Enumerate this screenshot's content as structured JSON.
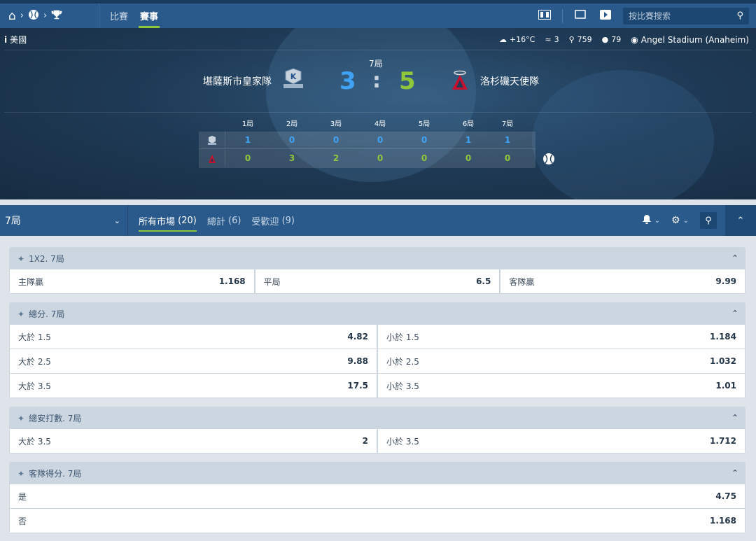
{
  "nav": {
    "tabs": [
      "比賽",
      "賽事"
    ],
    "active_tab": "賽事",
    "search_placeholder": "按比賽搜索"
  },
  "match": {
    "country": "美國",
    "weather": {
      "temp": "+16°C",
      "wind": "3",
      "pressure": "759",
      "humidity": "79"
    },
    "venue": "Angel Stadium (Anaheim)",
    "inning": "7局",
    "home_team": "堪薩斯市皇家隊",
    "away_team": "洛杉磯天使隊",
    "home_score": "3",
    "away_score": "5",
    "separator": ":",
    "innings": [
      "1局",
      "2局",
      "3局",
      "4局",
      "5局",
      "6局",
      "7局"
    ],
    "home_line": [
      "1",
      "0",
      "0",
      "0",
      "0",
      "1",
      "1"
    ],
    "away_line": [
      "0",
      "3",
      "2",
      "0",
      "0",
      "0",
      "0"
    ],
    "colors": {
      "home": "#3fa3f5",
      "away": "#8fc63c"
    }
  },
  "marketbar": {
    "period": "7局",
    "tabs": [
      {
        "label": "所有市場",
        "count": "(20)"
      },
      {
        "label": "總計",
        "count": "(6)"
      },
      {
        "label": "受歡迎",
        "count": "(9)"
      }
    ]
  },
  "markets": [
    {
      "title": "1X2. 7局",
      "rows": [
        [
          {
            "label": "主隊贏",
            "odd": "1.168"
          },
          {
            "label": "平局",
            "odd": "6.5"
          },
          {
            "label": "客隊贏",
            "odd": "9.99"
          }
        ]
      ]
    },
    {
      "title": "總分. 7局",
      "rows": [
        [
          {
            "label": "大於 1.5",
            "odd": "4.82"
          },
          {
            "label": "小於 1.5",
            "odd": "1.184"
          }
        ],
        [
          {
            "label": "大於 2.5",
            "odd": "9.88"
          },
          {
            "label": "小於 2.5",
            "odd": "1.032"
          }
        ],
        [
          {
            "label": "大於 3.5",
            "odd": "17.5"
          },
          {
            "label": "小於 3.5",
            "odd": "1.01"
          }
        ]
      ]
    },
    {
      "title": "總安打數. 7局",
      "rows": [
        [
          {
            "label": "大於 3.5",
            "odd": "2"
          },
          {
            "label": "小於 3.5",
            "odd": "1.712"
          }
        ]
      ]
    },
    {
      "title": "客隊得分. 7局",
      "rows": [
        [
          {
            "label": "是",
            "odd": "4.75"
          }
        ],
        [
          {
            "label": "否",
            "odd": "1.168"
          }
        ]
      ]
    }
  ]
}
